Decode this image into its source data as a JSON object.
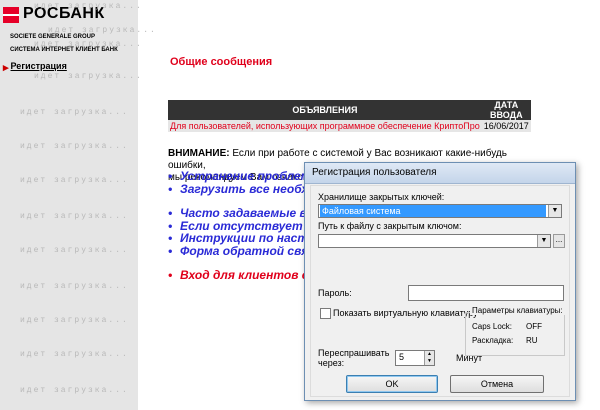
{
  "sidebar": {
    "logo_text": "РОСБАНК",
    "subtitle_group": "SOCIETE GENERALE GROUP",
    "subtitle_system": "СИСТЕМА ИНТЕРНЕТ КЛИЕНТ БАНК",
    "nav_marker": "▸",
    "nav_registration": "Регистрация",
    "ghost_text": "идет загрузка..."
  },
  "main": {
    "title": "Общие сообщения",
    "table": {
      "headers": [
        "ОБЪЯВЛЕНИЯ",
        "ДАТА ВВОДА"
      ],
      "rows": [
        [
          "Для пользователей, использующих программное обеспечение КриптоПро",
          "16/06/2017"
        ]
      ]
    },
    "warning_bold": "ВНИМАНИЕ:",
    "warning_line1": " Если при работе с системой у Вас возникают какие-нибудь ошибки,",
    "warning_line2": "мы рекомендуем Вам ознакоми",
    "links": [
      "Устранение проблем",
      "Загрузить все необх",
      "Часто задаваемые во",
      "Если отсутствует к",
      "Инструкции по настр",
      "Форма обратной связ"
    ],
    "login_link": "Вход для клиентов с"
  },
  "dialog": {
    "title": "Регистрация пользователя",
    "storage_label": "Хранилище закрытых ключей:",
    "storage_value": "Файловая система",
    "path_label": "Путь к файлу с закрытым ключом:",
    "path_value": "",
    "browse_label": "...",
    "password_label": "Пароль:",
    "password_value": "",
    "virtual_kb_label": "Показать виртуальную клавиатуру",
    "kb_params_label": "Параметры клавиатуры:",
    "caps_lock_label": "Caps Lock:",
    "caps_lock_value": "OFF",
    "layout_label": "Раскладка:",
    "layout_value": "RU",
    "reask_label_1": "Переспрашивать",
    "reask_label_2": "через:",
    "reask_value": "5",
    "minutes_label": "Минут",
    "ok_label": "OK",
    "cancel_label": "Отмена"
  }
}
